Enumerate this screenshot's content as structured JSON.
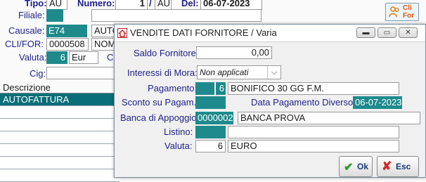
{
  "main": {
    "tipo_label": "Tipo:",
    "tipo_value": "AU",
    "numero_label": "Numero:",
    "numero_value": "1",
    "numero_slash": "/",
    "numero_suffix": "AU",
    "del_label": "Del:",
    "del_value": "06-07-2023",
    "filiale_label": "Filiale:",
    "causale_label": "Causale:",
    "causale_code": "E74",
    "causale_desc": "AUTO",
    "clifor_label": "CLI/FOR:",
    "clifor_code": "0000508",
    "clifor_name": "NOMI",
    "valuta_label": "Valuta:",
    "valuta_code": "6",
    "valuta_desc": "Eur",
    "c_label": "C",
    "cig_label": "Cig:",
    "descrizione_header": "Descrizione",
    "rows": [
      "AUTOFATTURA",
      "",
      "",
      "",
      "",
      "",
      ""
    ],
    "clifor_button": "Cli\nFor"
  },
  "dialog": {
    "title": "VENDITE DATI FORNITORE / Varia",
    "saldo_label": "Saldo Fornitore:",
    "saldo_value": "0,00",
    "interessi_label": "Interessi di Mora:",
    "interessi_value": "Non applicati",
    "pagamento_label": "Pagamento:",
    "pagamento_code": "6",
    "pagamento_desc": "BONIFICO 30 GG F.M.",
    "sconto_label": "Sconto su Pagam.:",
    "data_pag_label": "Data Pagamento Diverso:",
    "data_pag_value": "06-07-2023",
    "banca_label": "Banca di Appoggio:",
    "banca_code": "0000002",
    "banca_desc": "BANCA PROVA",
    "listino_label": "Listino:",
    "valuta_label": "Valuta:",
    "valuta_code": "6",
    "valuta_desc": "EURO",
    "ok_label": "Ok",
    "esc_label": "Esc"
  },
  "colors": {
    "teal": "#1e8a8c",
    "label": "#1f1f8a",
    "select": "#0a6e78"
  }
}
